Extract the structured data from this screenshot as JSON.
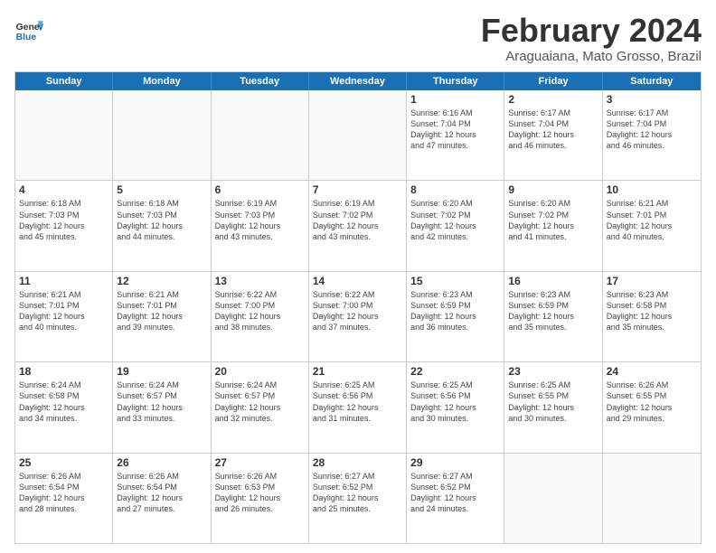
{
  "logo": {
    "line1": "General",
    "line2": "Blue"
  },
  "title": {
    "month": "February 2024",
    "location": "Araguaiana, Mato Grosso, Brazil"
  },
  "weekdays": [
    "Sunday",
    "Monday",
    "Tuesday",
    "Wednesday",
    "Thursday",
    "Friday",
    "Saturday"
  ],
  "rows": [
    [
      {
        "num": "",
        "info": ""
      },
      {
        "num": "",
        "info": ""
      },
      {
        "num": "",
        "info": ""
      },
      {
        "num": "",
        "info": ""
      },
      {
        "num": "1",
        "info": "Sunrise: 6:16 AM\nSunset: 7:04 PM\nDaylight: 12 hours\nand 47 minutes."
      },
      {
        "num": "2",
        "info": "Sunrise: 6:17 AM\nSunset: 7:04 PM\nDaylight: 12 hours\nand 46 minutes."
      },
      {
        "num": "3",
        "info": "Sunrise: 6:17 AM\nSunset: 7:04 PM\nDaylight: 12 hours\nand 46 minutes."
      }
    ],
    [
      {
        "num": "4",
        "info": "Sunrise: 6:18 AM\nSunset: 7:03 PM\nDaylight: 12 hours\nand 45 minutes."
      },
      {
        "num": "5",
        "info": "Sunrise: 6:18 AM\nSunset: 7:03 PM\nDaylight: 12 hours\nand 44 minutes."
      },
      {
        "num": "6",
        "info": "Sunrise: 6:19 AM\nSunset: 7:03 PM\nDaylight: 12 hours\nand 43 minutes."
      },
      {
        "num": "7",
        "info": "Sunrise: 6:19 AM\nSunset: 7:02 PM\nDaylight: 12 hours\nand 43 minutes."
      },
      {
        "num": "8",
        "info": "Sunrise: 6:20 AM\nSunset: 7:02 PM\nDaylight: 12 hours\nand 42 minutes."
      },
      {
        "num": "9",
        "info": "Sunrise: 6:20 AM\nSunset: 7:02 PM\nDaylight: 12 hours\nand 41 minutes."
      },
      {
        "num": "10",
        "info": "Sunrise: 6:21 AM\nSunset: 7:01 PM\nDaylight: 12 hours\nand 40 minutes."
      }
    ],
    [
      {
        "num": "11",
        "info": "Sunrise: 6:21 AM\nSunset: 7:01 PM\nDaylight: 12 hours\nand 40 minutes."
      },
      {
        "num": "12",
        "info": "Sunrise: 6:21 AM\nSunset: 7:01 PM\nDaylight: 12 hours\nand 39 minutes."
      },
      {
        "num": "13",
        "info": "Sunrise: 6:22 AM\nSunset: 7:00 PM\nDaylight: 12 hours\nand 38 minutes."
      },
      {
        "num": "14",
        "info": "Sunrise: 6:22 AM\nSunset: 7:00 PM\nDaylight: 12 hours\nand 37 minutes."
      },
      {
        "num": "15",
        "info": "Sunrise: 6:23 AM\nSunset: 6:59 PM\nDaylight: 12 hours\nand 36 minutes."
      },
      {
        "num": "16",
        "info": "Sunrise: 6:23 AM\nSunset: 6:59 PM\nDaylight: 12 hours\nand 35 minutes."
      },
      {
        "num": "17",
        "info": "Sunrise: 6:23 AM\nSunset: 6:58 PM\nDaylight: 12 hours\nand 35 minutes."
      }
    ],
    [
      {
        "num": "18",
        "info": "Sunrise: 6:24 AM\nSunset: 6:58 PM\nDaylight: 12 hours\nand 34 minutes."
      },
      {
        "num": "19",
        "info": "Sunrise: 6:24 AM\nSunset: 6:57 PM\nDaylight: 12 hours\nand 33 minutes."
      },
      {
        "num": "20",
        "info": "Sunrise: 6:24 AM\nSunset: 6:57 PM\nDaylight: 12 hours\nand 32 minutes."
      },
      {
        "num": "21",
        "info": "Sunrise: 6:25 AM\nSunset: 6:56 PM\nDaylight: 12 hours\nand 31 minutes."
      },
      {
        "num": "22",
        "info": "Sunrise: 6:25 AM\nSunset: 6:56 PM\nDaylight: 12 hours\nand 30 minutes."
      },
      {
        "num": "23",
        "info": "Sunrise: 6:25 AM\nSunset: 6:55 PM\nDaylight: 12 hours\nand 30 minutes."
      },
      {
        "num": "24",
        "info": "Sunrise: 6:26 AM\nSunset: 6:55 PM\nDaylight: 12 hours\nand 29 minutes."
      }
    ],
    [
      {
        "num": "25",
        "info": "Sunrise: 6:26 AM\nSunset: 6:54 PM\nDaylight: 12 hours\nand 28 minutes."
      },
      {
        "num": "26",
        "info": "Sunrise: 6:26 AM\nSunset: 6:54 PM\nDaylight: 12 hours\nand 27 minutes."
      },
      {
        "num": "27",
        "info": "Sunrise: 6:26 AM\nSunset: 6:53 PM\nDaylight: 12 hours\nand 26 minutes."
      },
      {
        "num": "28",
        "info": "Sunrise: 6:27 AM\nSunset: 6:52 PM\nDaylight: 12 hours\nand 25 minutes."
      },
      {
        "num": "29",
        "info": "Sunrise: 6:27 AM\nSunset: 6:52 PM\nDaylight: 12 hours\nand 24 minutes."
      },
      {
        "num": "",
        "info": ""
      },
      {
        "num": "",
        "info": ""
      }
    ]
  ]
}
